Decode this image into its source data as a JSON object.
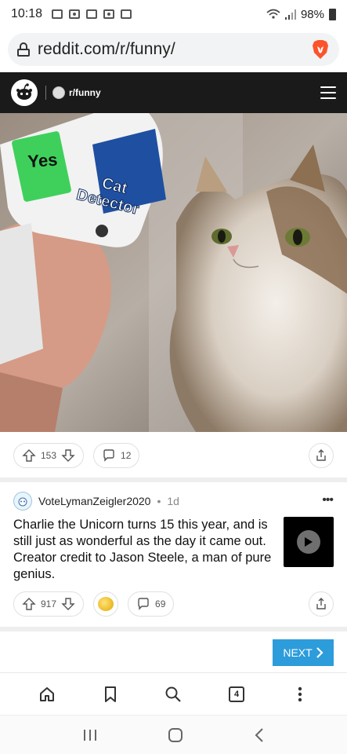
{
  "status_bar": {
    "time": "10:18",
    "battery": "98%"
  },
  "browser": {
    "url": "reddit.com/r/funny/",
    "tab_count": "4"
  },
  "header": {
    "subreddit": "r/funny"
  },
  "post1": {
    "image_text_screen": "Yes",
    "image_text_label": "Cat Detector",
    "upvotes": "153",
    "comments": "12"
  },
  "post2": {
    "author": "VoteLymanZeigler2020",
    "separator": "•",
    "age": "1d",
    "title": "Charlie the Unicorn turns 15 this year, and is still just as wonderful as the day it came out. Creator credit to Jason Steele, a man of pure genius.",
    "upvotes": "917",
    "comments": "69"
  },
  "pagination": {
    "next_label": "NEXT"
  },
  "colors": {
    "reddit_header": "#1a1a1b",
    "next_button": "#2d9cdb",
    "brave": "#fb542b"
  }
}
